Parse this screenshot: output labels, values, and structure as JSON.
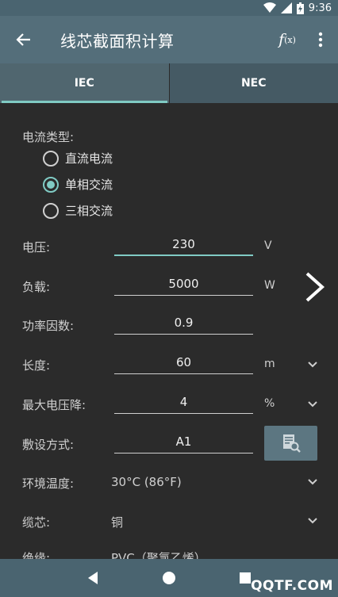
{
  "status_bar": {
    "time": "9:36"
  },
  "app_bar": {
    "title": "线芯截面积计算",
    "fx_main": "f",
    "fx_sub": "(x)"
  },
  "tabs": [
    {
      "label": "IEC",
      "active": true
    },
    {
      "label": "NEC",
      "active": false
    }
  ],
  "current_type": {
    "label": "电流类型:",
    "options": [
      {
        "label": "直流电流",
        "checked": false
      },
      {
        "label": "单相交流",
        "checked": true
      },
      {
        "label": "三相交流",
        "checked": false
      }
    ]
  },
  "fields": {
    "voltage": {
      "label": "电压:",
      "value": "230",
      "unit": "V"
    },
    "load": {
      "label": "负载:",
      "value": "5000",
      "unit": "W"
    },
    "power_factor": {
      "label": "功率因数:",
      "value": "0.9"
    },
    "length": {
      "label": "长度:",
      "value": "60",
      "unit": "m"
    },
    "max_voltage_drop": {
      "label": "最大电压降:",
      "value": "4",
      "unit": "%"
    },
    "installation": {
      "label": "敷设方式:",
      "value": "A1"
    }
  },
  "selects": {
    "ambient_temp": {
      "label": "环境温度:",
      "value": "30°C (86°F)"
    },
    "core": {
      "label": "缆芯:",
      "value": "铜"
    },
    "insulation": {
      "label": "绝缘:",
      "value": "PVC（聚氯乙烯）"
    }
  },
  "watermark": "QQTF.COM",
  "colors": {
    "accent": "#80cbc4",
    "app_bar": "#546e7a",
    "background": "#2b2b2b"
  }
}
